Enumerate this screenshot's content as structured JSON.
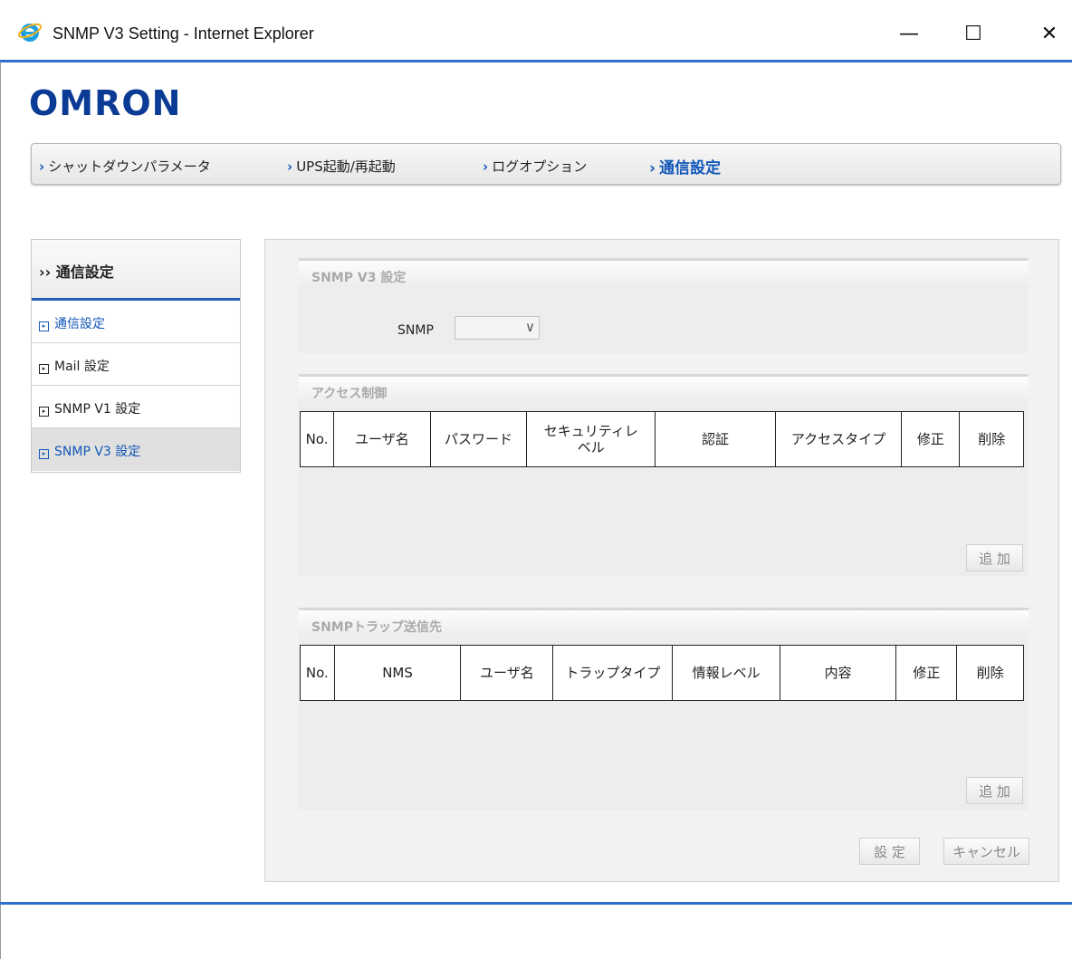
{
  "window": {
    "title": "SNMP V3 Setting - Internet Explorer",
    "minimize_glyph": "—",
    "maximize_glyph": "☐",
    "close_glyph": "✕",
    "icon": "internet-explorer-icon"
  },
  "brand": {
    "logo_text": "OMRON",
    "logo_color": "#0c3b95"
  },
  "topnav": {
    "arrow": "›",
    "items": [
      {
        "label": "シャットダウンパラメータ"
      },
      {
        "label": "UPS起動/再起動"
      },
      {
        "label": "ログオプション"
      },
      {
        "label": "通信設定"
      }
    ]
  },
  "sidebar": {
    "header": "›› 通信設定",
    "items": [
      {
        "label": "通信設定"
      },
      {
        "label": "Mail 設定"
      },
      {
        "label": "SNMP V1 設定"
      },
      {
        "label": "SNMP V3 設定"
      }
    ]
  },
  "snmp_section": {
    "title": "SNMP V3 設定",
    "snmp_label": "SNMP",
    "snmp_value": "",
    "chevron": "∨"
  },
  "access_section": {
    "title": "アクセス制御",
    "headers": [
      "No.",
      "ユーザ名",
      "パスワード",
      "セキュリティレベル",
      "認証",
      "アクセスタイプ",
      "修正",
      "削除"
    ],
    "rows": [],
    "add_button": "追 加"
  },
  "trap_section": {
    "title": "SNMPトラップ送信先",
    "headers": [
      "No.",
      "NMS",
      "ユーザ名",
      "トラップタイプ",
      "情報レベル",
      "内容",
      "修正",
      "削除"
    ],
    "rows": [],
    "add_button": "追 加"
  },
  "footer_buttons": {
    "apply": "設 定",
    "cancel": "キャンセル"
  },
  "colors": {
    "accent": "#1257b8",
    "divider_blue": "#2f6fd0"
  }
}
